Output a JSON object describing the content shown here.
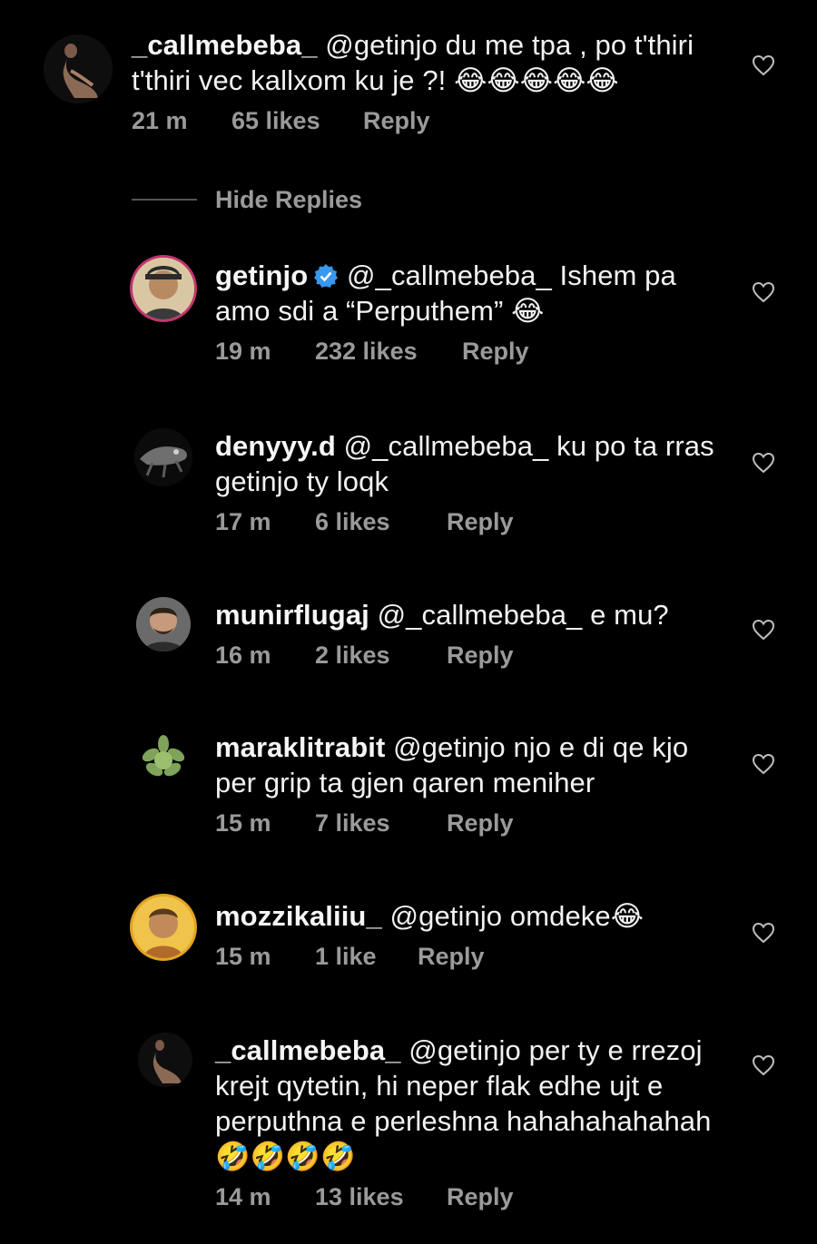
{
  "hide_replies_label": "Hide Replies",
  "reply_label": "Reply",
  "comments": [
    {
      "username": "_callmebeba_",
      "text": "@getinjo  du me tpa , po t'thiri t'thiri vec kallxom ku je ?! 😂😂😂😂😂",
      "time": "21 m",
      "likes": "65 likes"
    },
    {
      "username": "getinjo",
      "verified": true,
      "text": "@_callmebeba_ Ishem pa amo sdi a “Perputhem” 😂",
      "time": "19 m",
      "likes": "232 likes"
    },
    {
      "username": "denyyy.d",
      "text": "@_callmebeba_ ku po ta rras getinjo ty loqk",
      "time": "17 m",
      "likes": "6 likes"
    },
    {
      "username": "munirflugaj",
      "text": "@_callmebeba_ e mu?",
      "time": "16 m",
      "likes": "2 likes"
    },
    {
      "username": "maraklitrabit",
      "text": "@getinjo njo e di qe kjo per grip ta gjen qaren meniher",
      "time": "15 m",
      "likes": "7 likes"
    },
    {
      "username": "mozzikaliiu_",
      "text": "@getinjo omdeke😂",
      "time": "15 m",
      "likes": "1 like"
    },
    {
      "username": "_callmebeba_",
      "text": "@getinjo per ty e rrezoj krejt qytetin, hi neper flak edhe ujt e perputhna e perleshna hahahahahahah 🤣🤣🤣🤣",
      "time": "14 m",
      "likes": "13 likes"
    }
  ],
  "colors": {
    "background": "#000000",
    "text": "#f2f2f2",
    "meta": "#9a9a9a",
    "verified": "#3897f0"
  }
}
